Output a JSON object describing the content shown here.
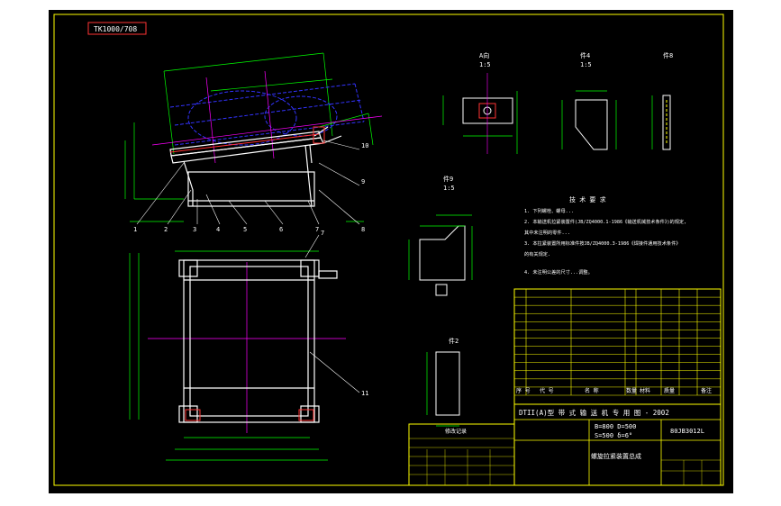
{
  "drawing": {
    "code_tag": "TK1000/708",
    "view_a": {
      "label": "A向",
      "scale": "1:5"
    },
    "part4": {
      "label": "件4",
      "scale": "1:5"
    },
    "part8": {
      "label": "件8",
      "scale": ""
    },
    "part9": {
      "label": "件9",
      "scale": "1:5"
    },
    "part2": {
      "label": "件2",
      "scale": ""
    },
    "tech_req_title": "技 术 要 求",
    "tech_req": [
      "1. 下列螺栓、螺母...",
      "2. 本输送机拉紧装置件(JB/ZQ4000.1-1986《输送机械技术条件》)的规定,",
      "   其中未注明的零件...",
      "3. 本拉紧装置所用标准件按JB/ZQ4000.3-1986《焊接件通用技术条件》",
      "   的有关规定.",
      "4. 未注明公差的尺寸...调整。"
    ],
    "callouts_top": [
      "1",
      "2",
      "3",
      "4",
      "5",
      "6",
      "7",
      "8",
      "9",
      "10"
    ],
    "callouts_bottom": [
      "7",
      "11"
    ],
    "bom_header": {
      "seq": "序 号",
      "code": "代  号",
      "name": "名  称",
      "qty": "数量",
      "material": "材料",
      "weight": "质量",
      "note": "备注"
    },
    "bom_rows": 13,
    "title_block": {
      "series": "DTII(A)型  带 式 输 送 机 专 用 图 - 2002",
      "params1": "B=800 D=500",
      "params2": "S=500 δ=6°",
      "drawing_no": "80JB3012L",
      "name": "螺旋拉紧装置总成",
      "revision_header": "修改记录"
    }
  },
  "colors": {
    "frame": "#ffff00",
    "paper": "#000000",
    "part": "#ffffff",
    "dim": "#00ff00",
    "center": "#ff00ff",
    "hidden": "#3333ff",
    "accent": "#ff3333",
    "table": "#ffff00"
  }
}
